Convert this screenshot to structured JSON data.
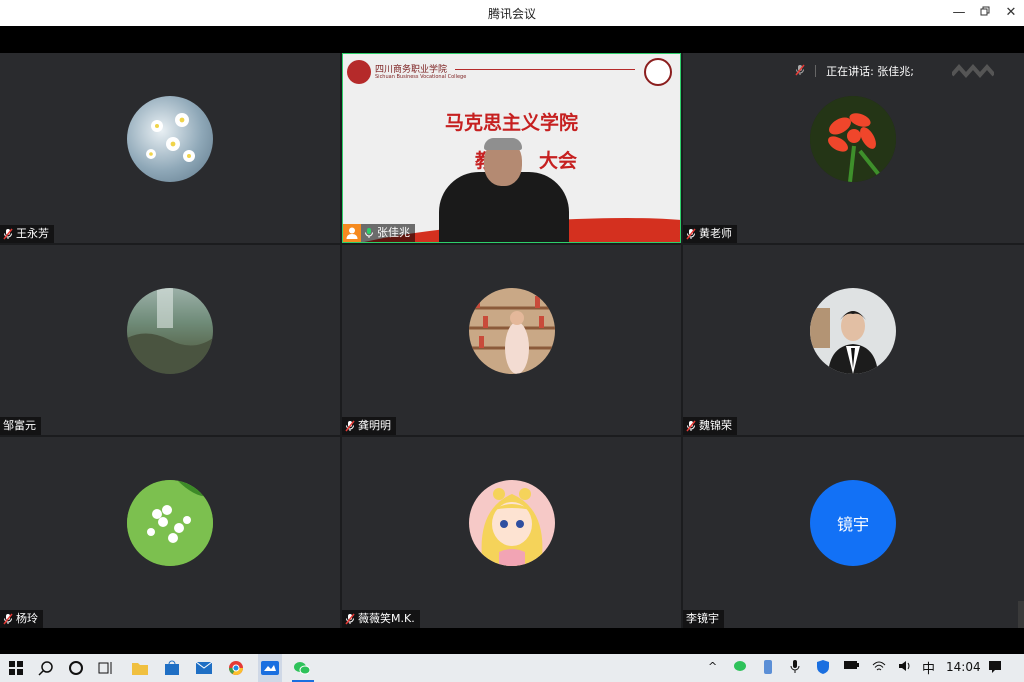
{
  "window": {
    "title": "腾讯会议"
  },
  "speaking": {
    "text": "正在讲话: 张佳兆;"
  },
  "tiles": [
    {
      "name": "王永芳",
      "mic": "muted"
    },
    {
      "name": "张佳兆",
      "mic": "active"
    },
    {
      "name": "黄老师",
      "mic": "muted"
    },
    {
      "name": "邹富元",
      "mic": "none"
    },
    {
      "name": "龚明明",
      "mic": "muted"
    },
    {
      "name": "魏锦荣",
      "mic": "muted"
    },
    {
      "name": "杨玲",
      "mic": "muted"
    },
    {
      "name": "薇薇笑M.K.",
      "mic": "muted"
    },
    {
      "name": "李镜宇",
      "mic": "none",
      "avatar_text": "镜宇"
    }
  ],
  "slide": {
    "college_cn": "四川商务职业学院",
    "college_en": "Sichuan Business Vocational College",
    "line1": "马克思主义学院",
    "line2_left": "教",
    "line2_right": "大会"
  },
  "taskbar": {
    "time": "14:04",
    "ime": "中"
  },
  "colors": {
    "tile_bg": "#2a2b2e",
    "avatar_blue": "#1271f6",
    "active_border": "#2ecf6b"
  }
}
